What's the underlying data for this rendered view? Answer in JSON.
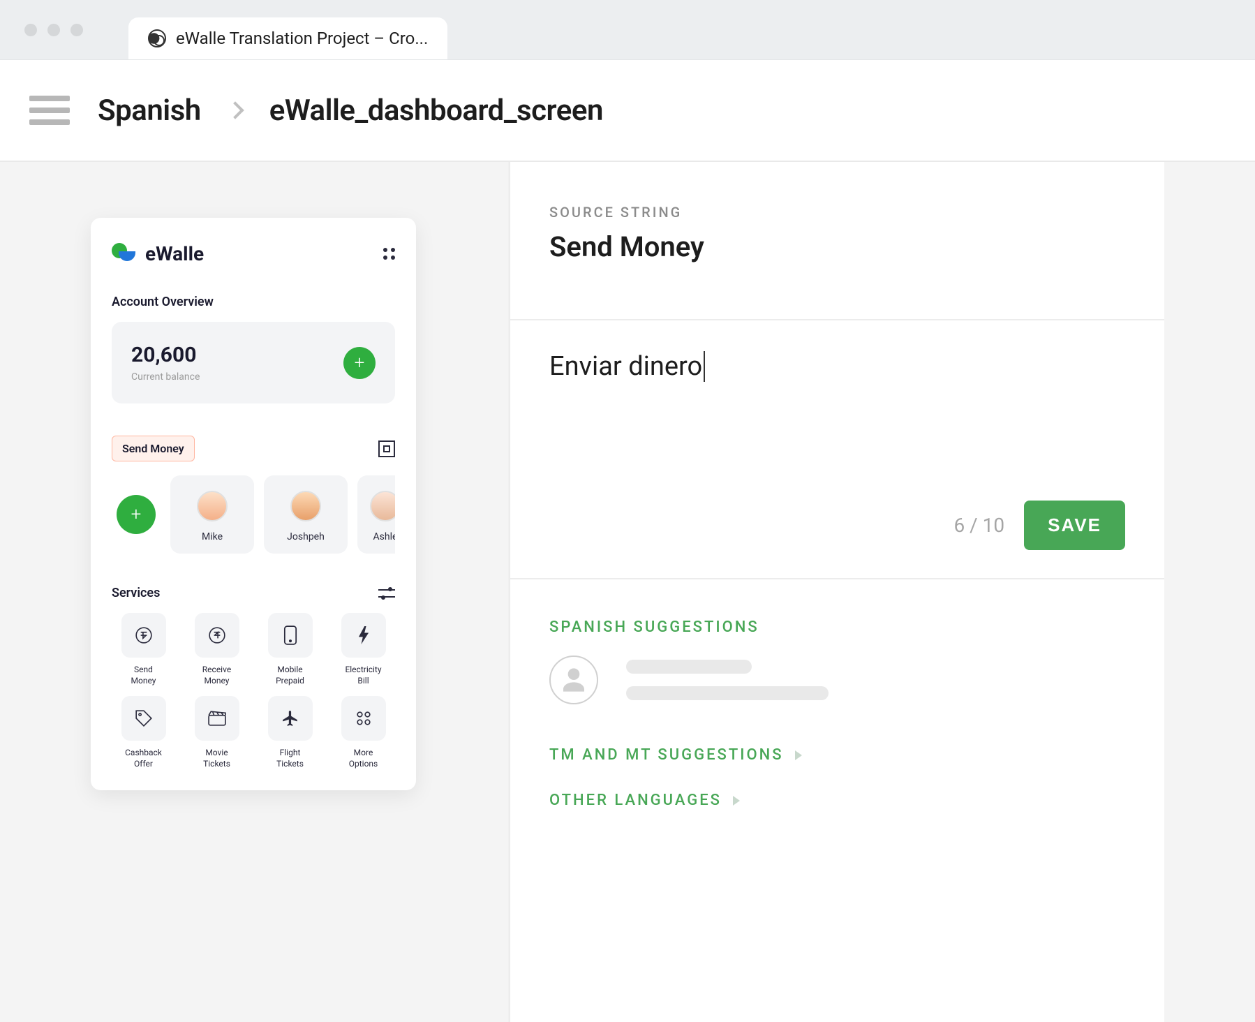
{
  "browser": {
    "tabTitle": "eWalle Translation Project – Cro..."
  },
  "breadcrumb": {
    "language": "Spanish",
    "file": "eWalle_dashboard_screen"
  },
  "preview": {
    "brand": "eWalle",
    "accountOverview": "Account Overview",
    "balanceValue": "20,600",
    "balanceCaption": "Current balance",
    "sendMoneyBadge": "Send Money",
    "contacts": [
      "Mike",
      "Joshpeh",
      "Ashle"
    ],
    "servicesTitle": "Services",
    "services": [
      "Send Money",
      "Receive Money",
      "Mobile Prepaid",
      "Electricity Bill",
      "Cashback Offer",
      "Movie Tickets",
      "Flight Tickets",
      "More Options"
    ]
  },
  "editor": {
    "sourceLabel": "SOURCE STRING",
    "sourceText": "Send Money",
    "translation": "Enviar dinero",
    "countCurrent": "6",
    "countTotal": "10",
    "saveLabel": "SAVE"
  },
  "suggestions": {
    "spanishTitle": "SPANISH SUGGESTIONS",
    "tmTitle": "TM AND MT SUGGESTIONS",
    "otherTitle": "OTHER LANGUAGES"
  }
}
